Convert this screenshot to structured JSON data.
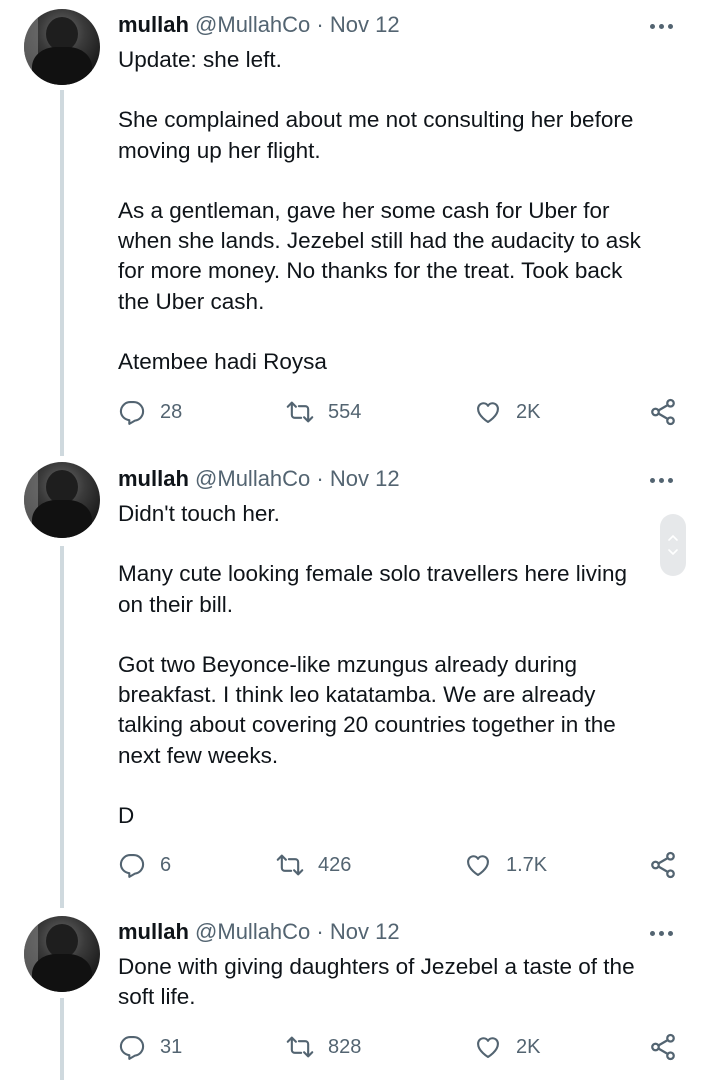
{
  "tweets": [
    {
      "name": "mullah",
      "handle_date": "@MullahCo · Nov 12",
      "paragraphs": [
        "Update: she left.",
        "She complained about me not consulting her before\nmoving up her flight.",
        "As a gentleman, gave her some cash for Uber for\nwhen she lands. Jezebel still had the audacity to ask\nfor more money. No thanks for the treat. Took back\nthe Uber cash.",
        "Atembee hadi Roysa"
      ],
      "replies": "28",
      "retweets": "554",
      "likes": "2K"
    },
    {
      "name": "mullah",
      "handle_date": "@MullahCo · Nov 12",
      "paragraphs": [
        "Didn't touch her.",
        "Many cute looking female solo travellers here living\non their bill.",
        "Got two Beyonce-like mzungus already during\nbreakfast. I think leo katatamba. We are already\ntalking about covering 20 countries together in the\nnext few weeks.",
        "D"
      ],
      "replies": "6",
      "retweets": "426",
      "likes": "1.7K"
    },
    {
      "name": "mullah",
      "handle_date": "@MullahCo · Nov 12",
      "paragraphs": [
        "Done with giving daughters of Jezebel a taste of the\nsoft life."
      ],
      "replies": "31",
      "retweets": "828",
      "likes": "2K"
    }
  ],
  "icons": {
    "reply": "reply-icon",
    "retweet": "retweet-icon",
    "like": "heart-icon",
    "share": "share-icon",
    "more": "more-icon",
    "scroll_up": "chevron-up-icon",
    "scroll_down": "chevron-down-icon"
  },
  "colors": {
    "text": "#0f1419",
    "secondary": "#536471",
    "thread_line": "#cfd9de"
  }
}
